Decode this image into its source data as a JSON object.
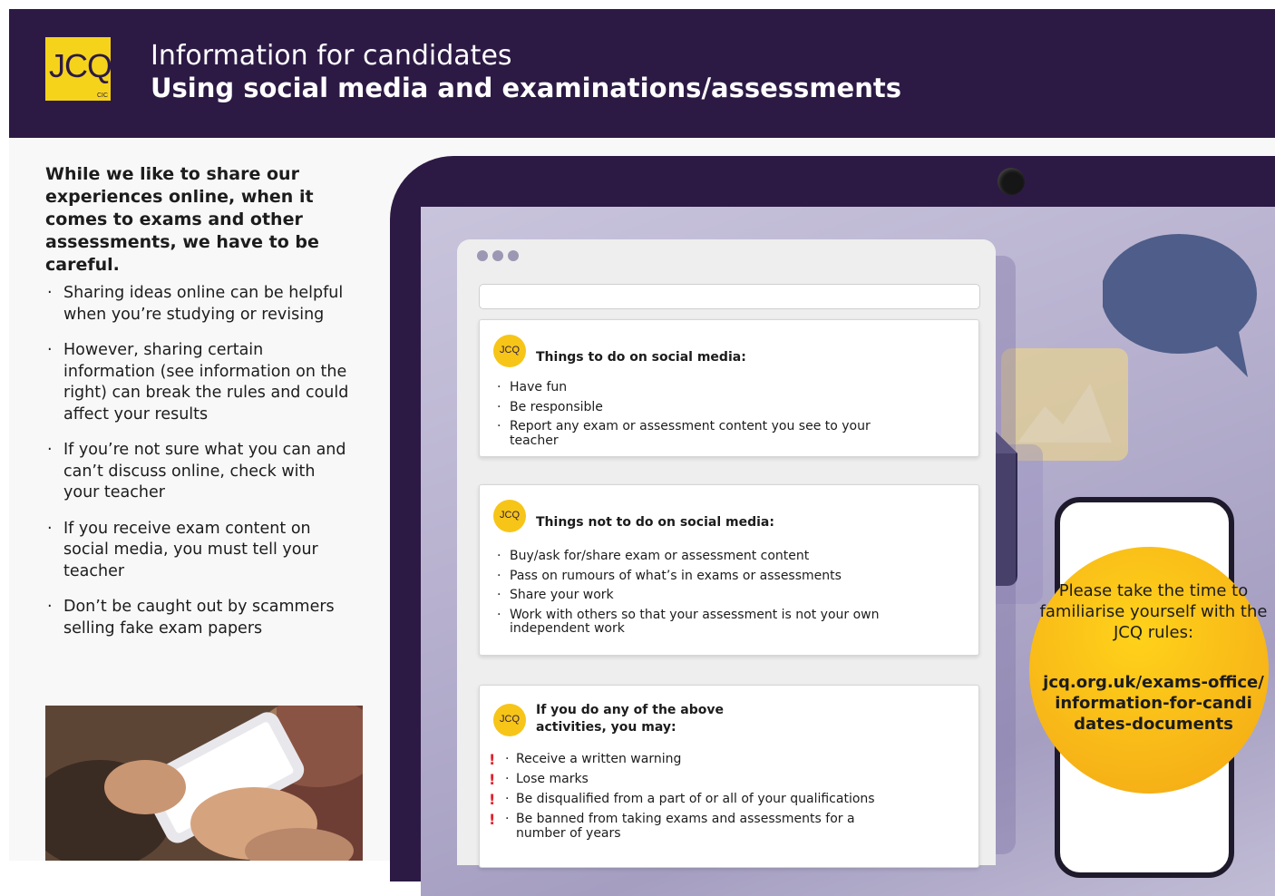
{
  "header": {
    "logo_text": "JCQ",
    "logo_subtext": "CIC",
    "title_line1": "Information for candidates",
    "title_line2": "Using social media and examinations/assessments"
  },
  "intro": "While we like to share our experiences online, when it comes to exams and other assessments, we have to be careful.",
  "bullets": [
    "Sharing ideas online can be helpful when you’re studying or revising",
    "However, sharing certain information (see information on the right) can break the rules and could affect your results",
    "If you’re not sure what you can and can’t discuss online, check with your teacher",
    "If you receive exam content on social media, you must tell your teacher",
    "Don’t be caught out by scammers selling fake exam papers"
  ],
  "cards": [
    {
      "logo": "JCQ",
      "title": "Things to do on social media:",
      "items": [
        "Have fun",
        "Be responsible",
        "Report any exam or assessment content you see to your teacher"
      ]
    },
    {
      "logo": "JCQ",
      "title": "Things not to do on social media:",
      "items": [
        "Buy/ask for/share exam or assessment content",
        "Pass on rumours of what’s in exams or assessments",
        "Share your work",
        "Work with others so that your assessment is not your own independent work"
      ]
    },
    {
      "logo": "JCQ",
      "title": "If you do any of the above activities, you may:",
      "items": [
        "Receive a written warning",
        "Lose marks",
        "Be disqualified from a part of or all of your qualifications",
        "Be banned from taking exams and assessments for a number of years"
      ]
    }
  ],
  "bullet_char": "·",
  "warning_char": "!",
  "cta": {
    "text": "Please take the time to familiarise yourself with the JCQ rules:",
    "link_line1": "jcq.org.uk/exams-office/",
    "link_line2": "information-for-candi",
    "link_line3": "dates-documents"
  },
  "colors": {
    "header_bg": "#2c1a45",
    "logo_yellow": "#f6d31b",
    "cta_yellow": "#f8b818",
    "warning_red": "#e0232e",
    "bubble_blue": "#4e5d89"
  },
  "icons": [
    "speech-bubble-icon",
    "image-icon",
    "alert-document-icon",
    "webcam-icon",
    "smartphone-icon"
  ]
}
